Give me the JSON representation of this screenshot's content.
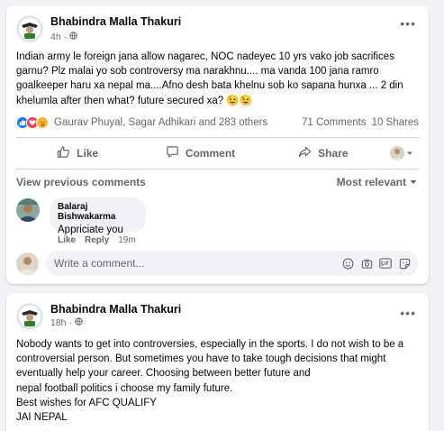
{
  "post1": {
    "author": "Bhabindra Malla Thakuri",
    "time": "4h",
    "text": "Indian army le foreign jana allow nagarec, NOC nadeyec 10 yrs vako job sacrifices garnu? Plz malai yo sob controversy ma narakhnu.... ma vanda 100 jana ramro goalkeeper haru xa nepal ma....Afno desh bata khelnu sob ko sapana hunxa ... 2 din khelumla after then what? future secured xa? 😉😉",
    "reactions": {
      "icons": [
        "like-icon",
        "love-icon",
        "care-icon"
      ],
      "names": "Gaurav Phuyal, Sagar Adhikari and 283 others",
      "comments": "71 Comments",
      "shares": "10 Shares"
    },
    "actions": {
      "like": "Like",
      "comment": "Comment",
      "share": "Share"
    },
    "view_previous": "View previous comments",
    "sort": "Most relevant",
    "comment": {
      "name": "Balaraj Bishwakarma",
      "text": "Appriciate you",
      "like": "Like",
      "reply": "Reply",
      "time": "19m"
    },
    "composer_placeholder": "Write a comment..."
  },
  "post2": {
    "author": "Bhabindra Malla Thakuri",
    "time": "18h",
    "text": "Nobody wants to get into controversies, especially in the sports. I do not wish to be a controversial person. But sometimes you have to take tough decisions that might eventually help your career. Choosing between better future and\nnepal football politics i choose my family future.\nBest wishes for AFC QUALIFY\nJAI NEPAL"
  },
  "colors": {
    "background": "#f0f2f5",
    "card": "#ffffff",
    "secondary_text": "#65676b",
    "like_blue": "#1877f2",
    "love_red": "#f33e58",
    "care_yellow": "#f7b928"
  }
}
